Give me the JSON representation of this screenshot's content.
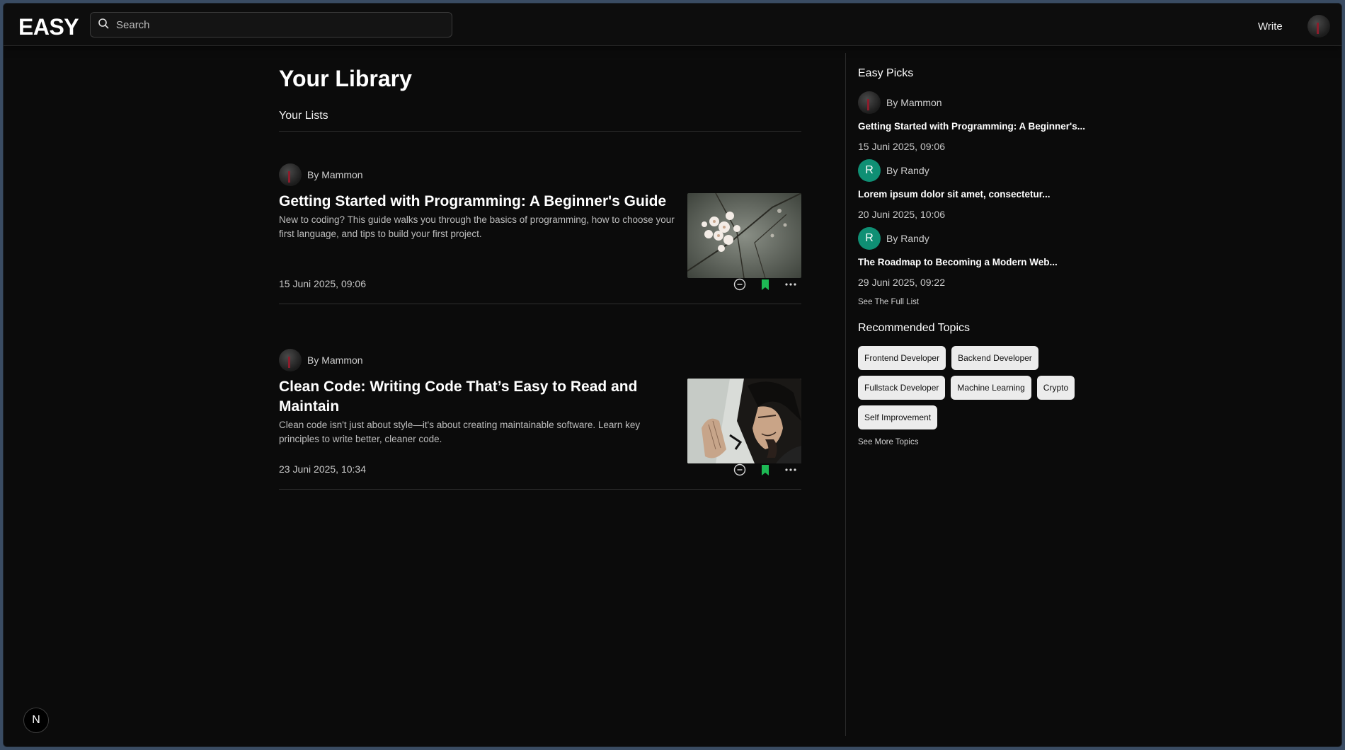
{
  "header": {
    "logo": "EASY",
    "search_placeholder": "Search",
    "write_label": "Write",
    "avatar_icon": "user-avatar"
  },
  "main": {
    "title": "Your Library",
    "tab_label": "Your Lists",
    "articles": [
      {
        "author": "By Mammon",
        "title": "Getting Started with Programming: A Beginner's Guide",
        "excerpt": "New to coding? This guide walks you through the basics of programming, how to choose your first language, and tips to build your first project.",
        "date": "15 Juni 2025, 09:06",
        "thumbnail": "cherry-blossom-photo"
      },
      {
        "author": "By Mammon",
        "title": "Clean Code: Writing Code That’s Easy to Read and Maintain",
        "excerpt": "Clean code isn't just about style—it's about creating maintainable software. Learn key principles to write better, cleaner code.",
        "date": "23 Juni 2025, 10:34",
        "thumbnail": "praying-samurai-illustration"
      }
    ],
    "action_icons": [
      "remove-circle-icon",
      "bookmark-icon",
      "more-icon"
    ]
  },
  "sidebar": {
    "picks_heading": "Easy Picks",
    "picks": [
      {
        "author": "By Mammon",
        "avatar": "image",
        "title": "Getting Started with Programming: A Beginner's...",
        "date": "15 Juni 2025, 09:06"
      },
      {
        "author": "By Randy",
        "avatar": "R",
        "title": "Lorem ipsum dolor sit amet, consectetur...",
        "date": "20 Juni 2025, 10:06"
      },
      {
        "author": "By Randy",
        "avatar": "R",
        "title": "The Roadmap to Becoming a Modern Web...",
        "date": "29 Juni 2025, 09:22"
      }
    ],
    "see_full_list": "See The Full List",
    "topics_heading": "Recommended Topics",
    "topics": [
      "Frontend Developer",
      "Backend Developer",
      "Fullstack Developer",
      "Machine Learning",
      "Crypto",
      "Self Improvement"
    ],
    "see_more_topics": "See More Topics"
  },
  "dev_badge": "N",
  "colors": {
    "background": "#0b0b0b",
    "accent_green": "#1db954",
    "avatar_teal": "#0f8f74",
    "chip_bg": "#ececec"
  }
}
